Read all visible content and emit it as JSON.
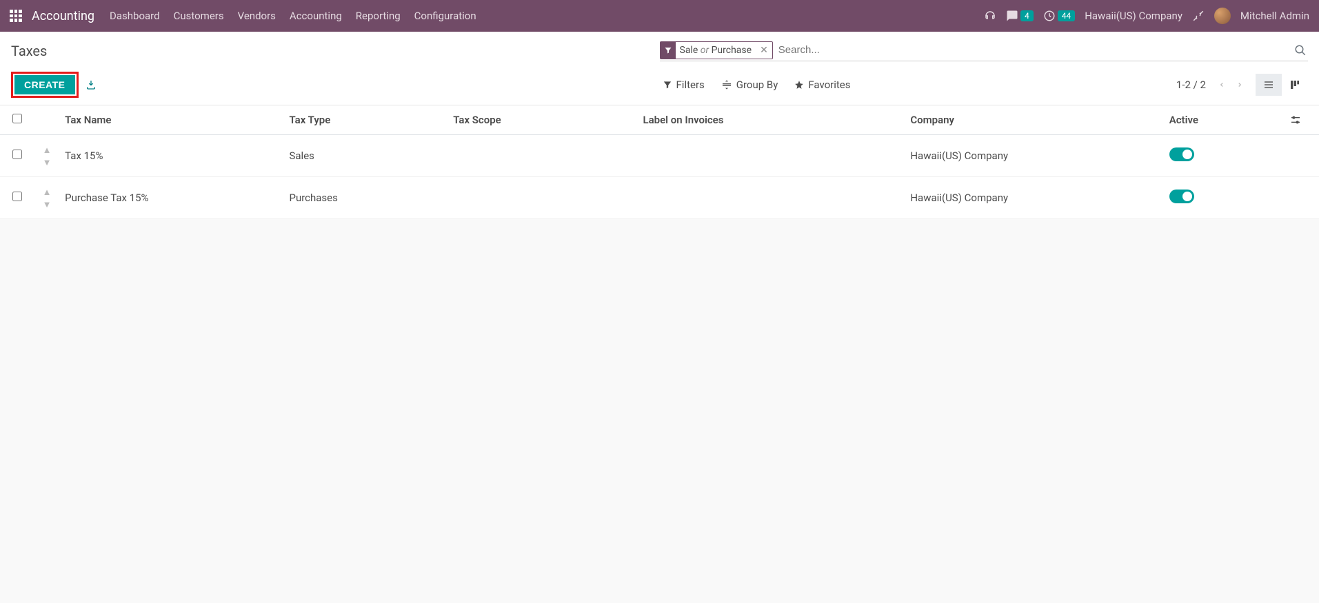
{
  "navbar": {
    "brand": "Accounting",
    "menu": [
      "Dashboard",
      "Customers",
      "Vendors",
      "Accounting",
      "Reporting",
      "Configuration"
    ],
    "messages_count": "4",
    "activities_count": "44",
    "company": "Hawaii(US) Company",
    "user": "Mitchell Admin"
  },
  "control_panel": {
    "title": "Taxes",
    "create_label": "CREATE",
    "facet": {
      "left": "Sale",
      "sep": "or",
      "right": "Purchase"
    },
    "search_placeholder": "Search...",
    "filters_label": "Filters",
    "groupby_label": "Group By",
    "favorites_label": "Favorites",
    "pager": "1-2 / 2"
  },
  "table": {
    "headers": {
      "name": "Tax Name",
      "type": "Tax Type",
      "scope": "Tax Scope",
      "label": "Label on Invoices",
      "company": "Company",
      "active": "Active"
    },
    "rows": [
      {
        "name": "Tax 15%",
        "type": "Sales",
        "scope": "",
        "label": "",
        "company": "Hawaii(US) Company",
        "active": true
      },
      {
        "name": "Purchase Tax 15%",
        "type": "Purchases",
        "scope": "",
        "label": "",
        "company": "Hawaii(US) Company",
        "active": true
      }
    ]
  }
}
